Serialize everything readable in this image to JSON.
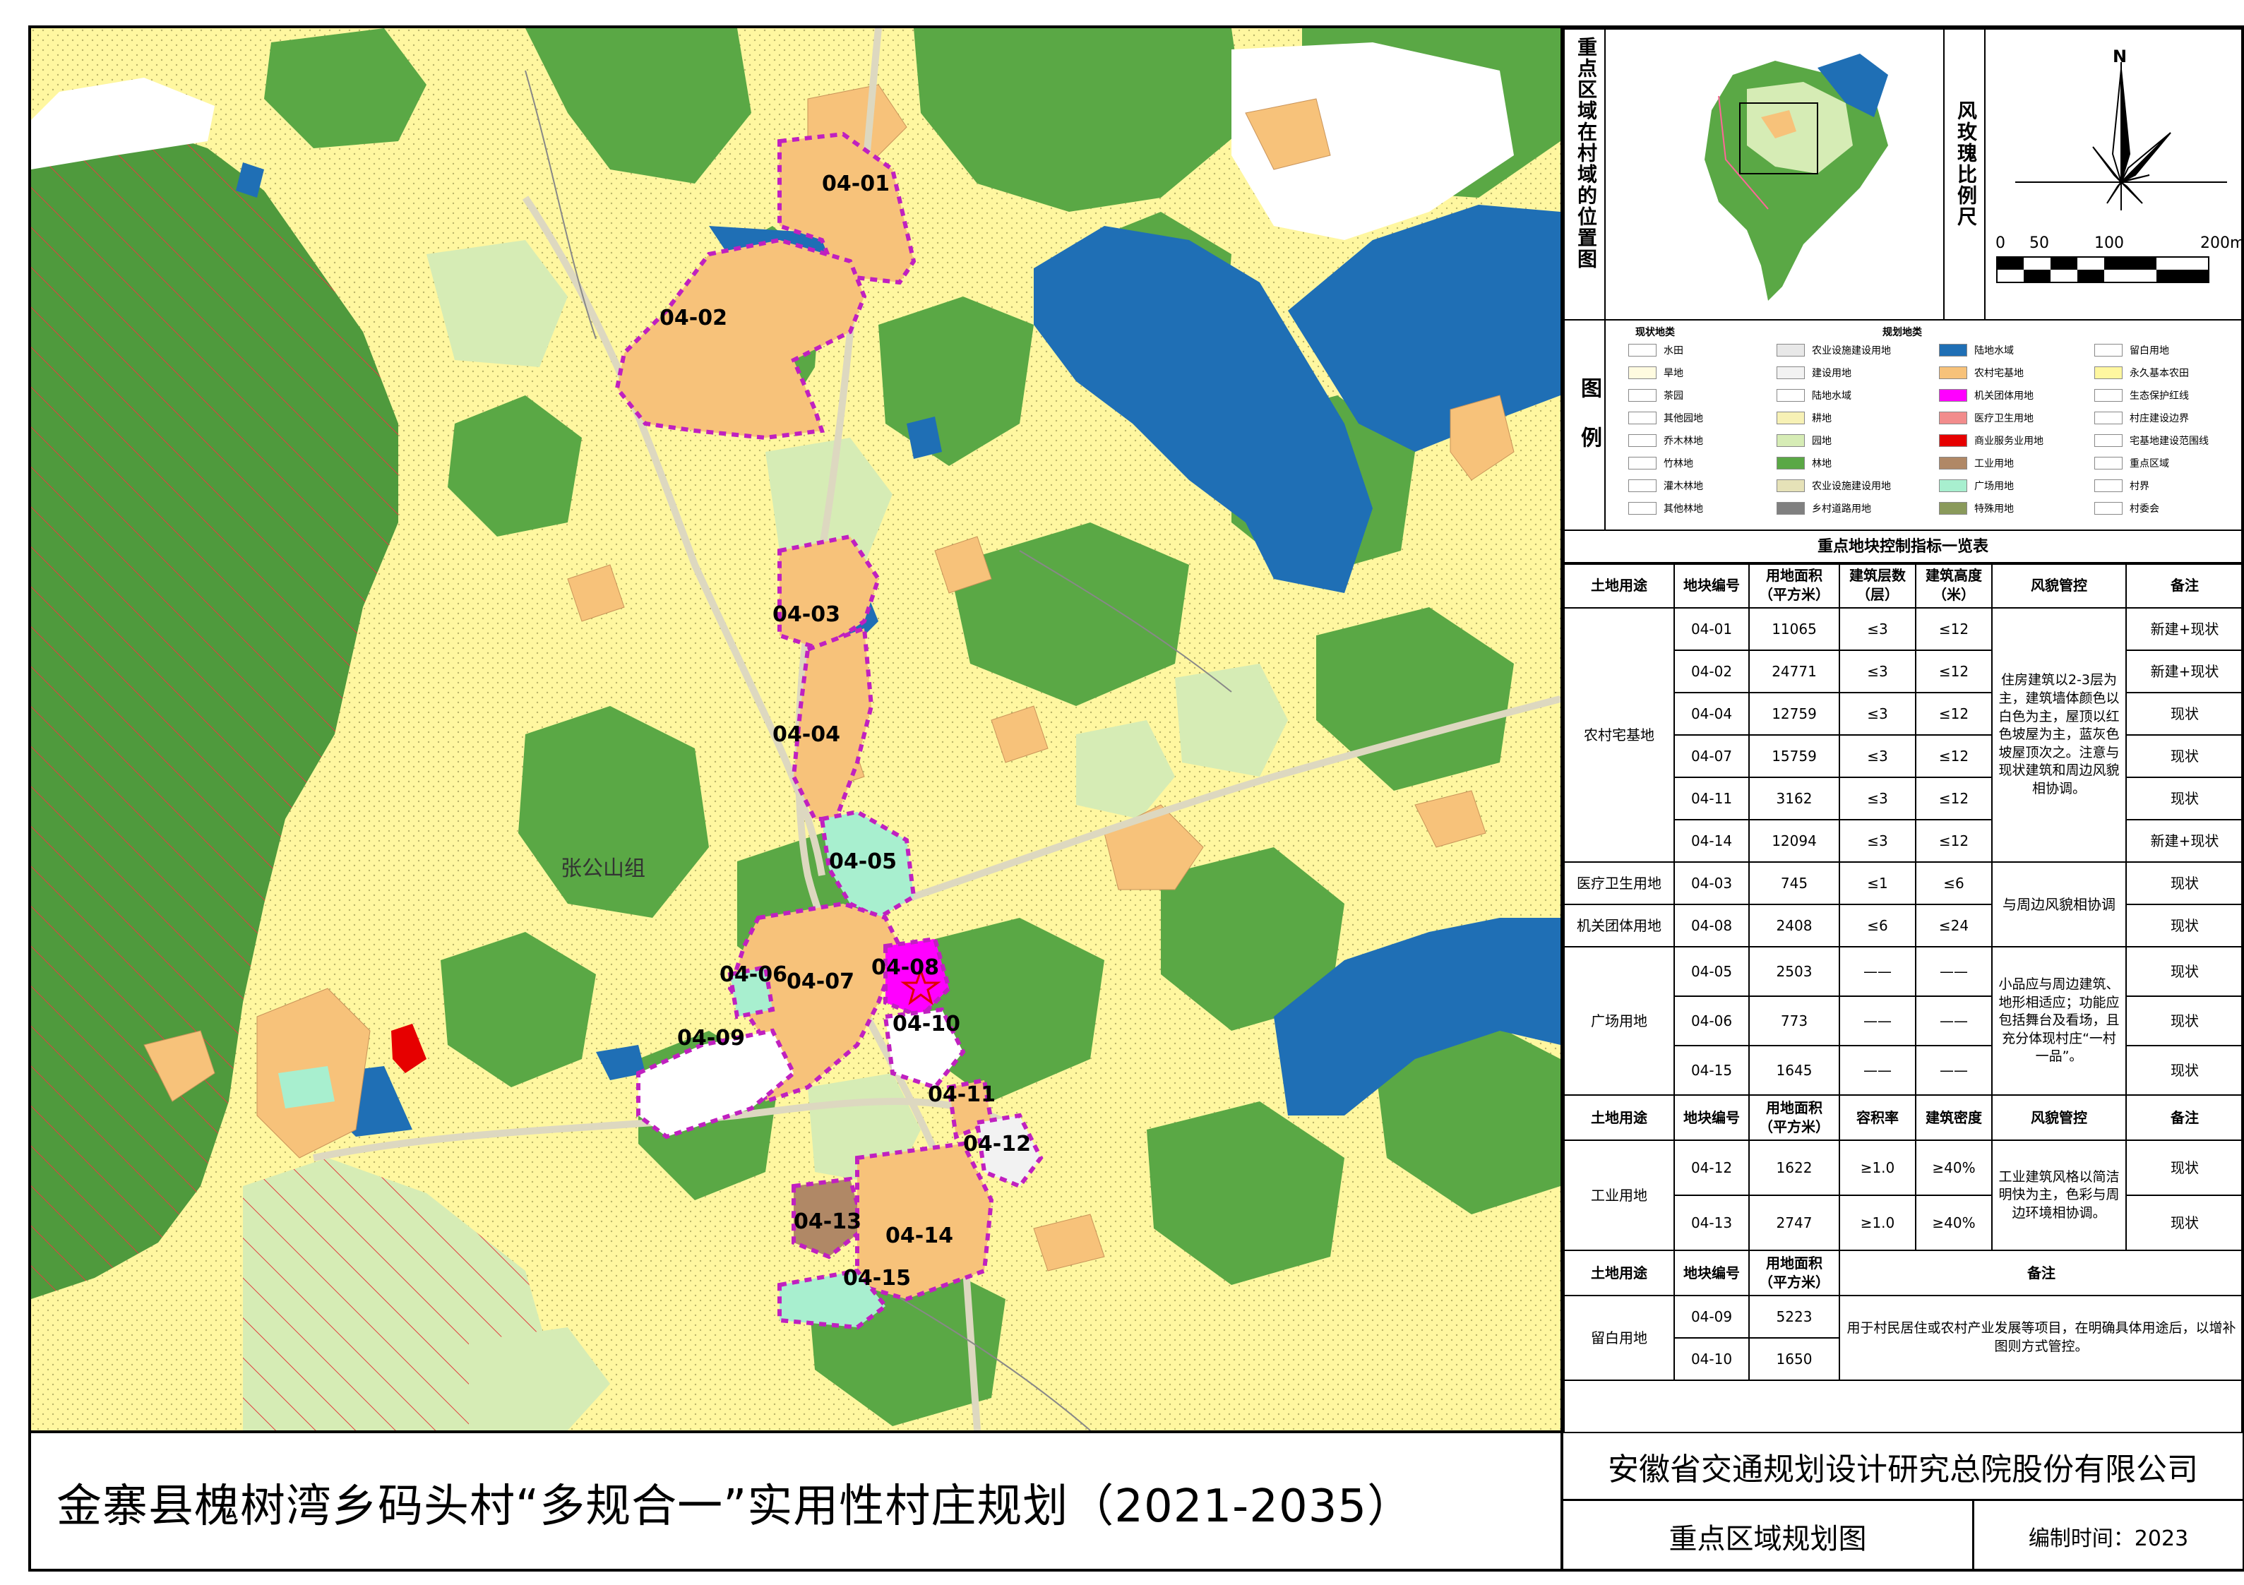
{
  "title": "金寨县槐树湾乡码头村“多规合一”实用性村庄规划（2021-2035）",
  "company": "安徽省交通规划设计研究总院股份有限公司",
  "drawing_name": "重点区域规划图",
  "date_label": "编制时间：2023",
  "map": {
    "group_label": "张公山组",
    "parcels": [
      "04-01",
      "04-02",
      "04-03",
      "04-04",
      "04-05",
      "04-06",
      "04-07",
      "04-08",
      "04-09",
      "04-10",
      "04-11",
      "04-12",
      "04-13",
      "04-14",
      "04-15"
    ]
  },
  "locator": {
    "label": "重点区域在村域的位置图"
  },
  "compass": {
    "label": "风玫瑰比例尺",
    "north": "N",
    "scale_ticks": [
      "0",
      "50",
      "100",
      "200m"
    ]
  },
  "legend": {
    "label": "图例",
    "group_current": "现状地类",
    "group_planned": "规划地类",
    "items": [
      {
        "name": "水田",
        "color": "#ffffff"
      },
      {
        "name": "农业设施建设用地",
        "color": "#e8e8e8"
      },
      {
        "name": "陆地水域",
        "color": "#1f6fb5"
      },
      {
        "name": "留白用地",
        "color": "#ffffff"
      },
      {
        "name": "旱地",
        "color": "#fffbe0"
      },
      {
        "name": "建设用地",
        "color": "#f2f2f2"
      },
      {
        "name": "农村宅基地",
        "color": "#f7c27a"
      },
      {
        "name": "永久基本农田",
        "color": "#fff7a0"
      },
      {
        "name": "茶园",
        "color": "#ffffff"
      },
      {
        "name": "陆地水域",
        "color": "#ffffff"
      },
      {
        "name": "机关团体用地",
        "color": "#ff00ff"
      },
      {
        "name": "生态保护红线",
        "color": "#ffffff"
      },
      {
        "name": "其他园地",
        "color": "#ffffff"
      },
      {
        "name": "耕地",
        "color": "#f7f1b5"
      },
      {
        "name": "医疗卫生用地",
        "color": "#f28c8c"
      },
      {
        "name": "村庄建设边界",
        "color": "#ffffff"
      },
      {
        "name": "乔木林地",
        "color": "#ffffff"
      },
      {
        "name": "园地",
        "color": "#d6ecb5"
      },
      {
        "name": "商业服务业用地",
        "color": "#e60000"
      },
      {
        "name": "宅基地建设范围线",
        "color": "#ffffff"
      },
      {
        "name": "竹林地",
        "color": "#ffffff"
      },
      {
        "name": "林地",
        "color": "#5aa845"
      },
      {
        "name": "工业用地",
        "color": "#b08866"
      },
      {
        "name": "重点区域",
        "color": "#ffffff"
      },
      {
        "name": "灌木林地",
        "color": "#ffffff"
      },
      {
        "name": "农业设施建设用地",
        "color": "#e6e2b8"
      },
      {
        "name": "广场用地",
        "color": "#a8efcf"
      },
      {
        "name": "村界",
        "color": "#ffffff"
      },
      {
        "name": "其他林地",
        "color": "#ffffff"
      },
      {
        "name": "乡村道路用地",
        "color": "#808080"
      },
      {
        "name": "特殊用地",
        "color": "#8a9a5b"
      },
      {
        "name": "村委会",
        "color": "#ffffff"
      }
    ]
  },
  "table": {
    "caption": "重点地块控制指标一览表",
    "head1": [
      "土地用途",
      "地块编号",
      "用地面积（平方米）",
      "建筑层数（层）",
      "建筑高度（米）",
      "风貌管控",
      "备注"
    ],
    "residential": {
      "use": "农村宅基地",
      "style": "住房建筑以2-3层为主，建筑墙体颜色以白色为主，屋顶以红色坡屋为主，蓝灰色坡屋顶次之。注意与现状建筑和周边风貌相协调。",
      "rows": [
        [
          "04-01",
          "11065",
          "≤3",
          "≤12",
          "新建+现状"
        ],
        [
          "04-02",
          "24771",
          "≤3",
          "≤12",
          "新建+现状"
        ],
        [
          "04-04",
          "12759",
          "≤3",
          "≤12",
          "现状"
        ],
        [
          "04-07",
          "15759",
          "≤3",
          "≤12",
          "现状"
        ],
        [
          "04-11",
          "3162",
          "≤3",
          "≤12",
          "现状"
        ],
        [
          "04-14",
          "12094",
          "≤3",
          "≤12",
          "新建+现状"
        ]
      ]
    },
    "medical": {
      "use": "医疗卫生用地",
      "row": [
        "04-03",
        "745",
        "≤1",
        "≤6",
        "现状"
      ]
    },
    "office": {
      "use": "机关团体用地",
      "row": [
        "04-08",
        "2408",
        "≤6",
        "≤24",
        "现状"
      ]
    },
    "style_medical_office": "与周边风貌相协调",
    "square": {
      "use": "广场用地",
      "style": "小品应与周边建筑、地形相适应；功能应包括舞台及看场，且充分体现村庄“一村一品”。",
      "rows": [
        [
          "04-05",
          "2503",
          "——",
          "——",
          "现状"
        ],
        [
          "04-06",
          "773",
          "——",
          "——",
          "现状"
        ],
        [
          "04-15",
          "1645",
          "——",
          "——",
          "现状"
        ]
      ]
    },
    "head2": [
      "土地用途",
      "地块编号",
      "用地面积（平方米）",
      "容积率",
      "建筑密度",
      "风貌管控",
      "备注"
    ],
    "industrial": {
      "use": "工业用地",
      "style": "工业建筑风格以简洁明快为主，色彩与周边环境相协调。",
      "rows": [
        [
          "04-12",
          "1622",
          "≥1.0",
          "≥40%",
          "现状"
        ],
        [
          "04-13",
          "2747",
          "≥1.0",
          "≥40%",
          "现状"
        ]
      ]
    },
    "head3": [
      "土地用途",
      "地块编号",
      "用地面积（平方米）",
      "备注"
    ],
    "reserve": {
      "use": "留白用地",
      "note": "用于村民居住或农村产业发展等项目，在明确具体用途后，以增补图则方式管控。",
      "rows": [
        [
          "04-09",
          "5223"
        ],
        [
          "04-10",
          "1650"
        ]
      ]
    }
  }
}
